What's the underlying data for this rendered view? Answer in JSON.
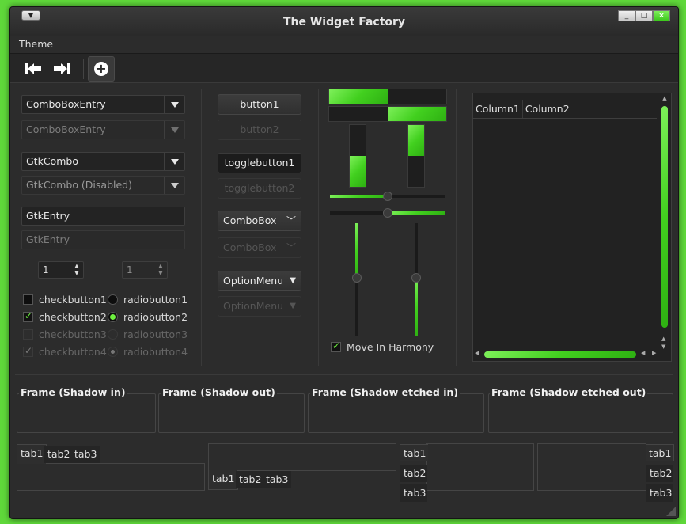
{
  "window": {
    "title": "The Widget Factory",
    "menu_icon": "menu-arrow-icon",
    "buttons": [
      "minimize-icon",
      "maximize-icon",
      "close-icon"
    ]
  },
  "menubar": {
    "items": [
      "Theme"
    ]
  },
  "toolbar": {
    "buttons": [
      "goto-first-icon",
      "goto-last-icon",
      "add-icon"
    ]
  },
  "left_col": {
    "combo_entry": "ComboBoxEntry",
    "combo_entry_disabled": "ComboBoxEntry",
    "gtk_combo": "GtkCombo",
    "gtk_combo_disabled": "GtkCombo (Disabled)",
    "entry": "GtkEntry",
    "entry_disabled": "GtkEntry",
    "spin1": "1",
    "spin2": "1",
    "checks": [
      "checkbutton1",
      "checkbutton2",
      "checkbutton3",
      "checkbutton4"
    ],
    "radios": [
      "radiobutton1",
      "radiobutton2",
      "radiobutton3",
      "radiobutton4"
    ]
  },
  "mid_col": {
    "button1": "button1",
    "button2": "button2",
    "toggle1": "togglebutton1",
    "toggle2": "togglebutton2",
    "combobox": "ComboBox",
    "combobox_disabled": "ComboBox",
    "optionmenu": "OptionMenu",
    "optionmenu_disabled": "OptionMenu"
  },
  "progress": {
    "hbar1": 0.5,
    "hbar2": 0.5,
    "vbar1": 0.5,
    "vbar2": 0.5,
    "hscale1": 0.5,
    "hscale2": 0.5,
    "vscale1": 0.48,
    "vscale2": 0.48,
    "harmony_label": "Move In Harmony"
  },
  "tree": {
    "columns": [
      "Column1",
      "Column2"
    ]
  },
  "frames": [
    "Frame (Shadow in)",
    "Frame (Shadow out)",
    "Frame (Shadow etched in)",
    "Frame (Shadow etched out)"
  ],
  "notebooks": {
    "tabs": [
      "tab1",
      "tab2",
      "tab3"
    ]
  },
  "colors": {
    "accent": "#5fd83a",
    "window_bg": "#2c2c2c"
  }
}
